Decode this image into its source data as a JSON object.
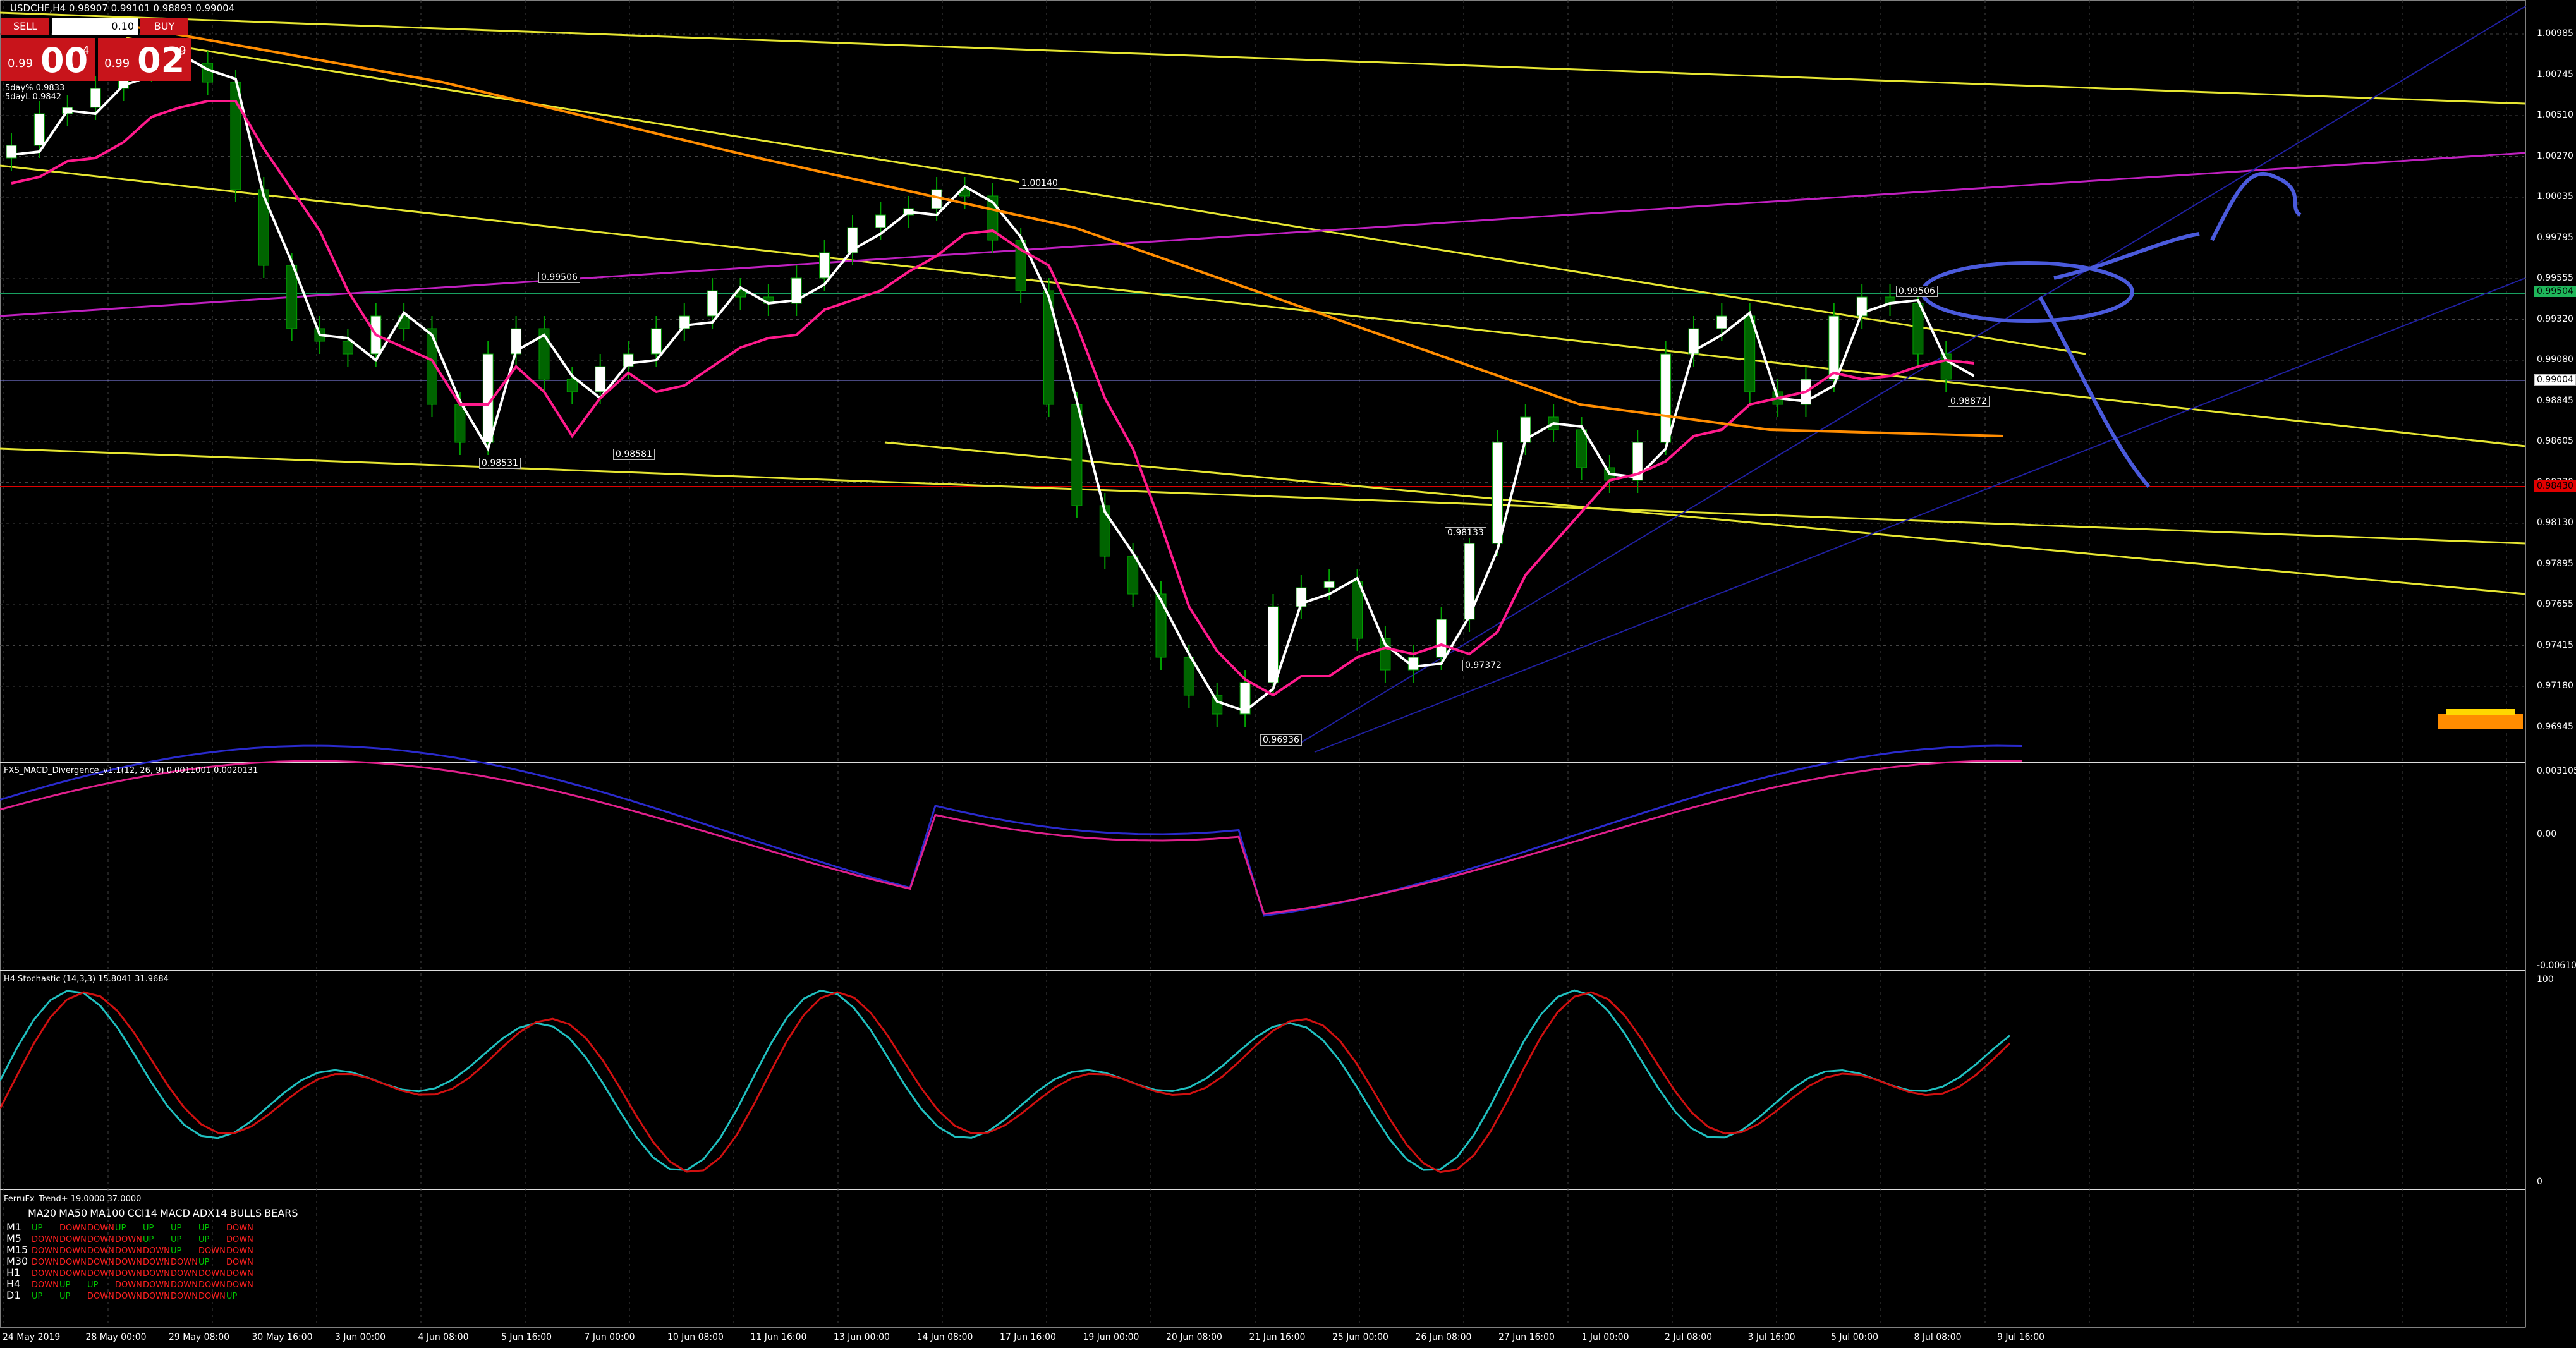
{
  "chart": {
    "title": "USDCHF,H4",
    "ohlc": "0.98907 0.99101 0.98893 0.99004",
    "ma_labels": [
      "5day% 0.9833",
      "5dayL 0.9842"
    ],
    "current_price": "0.99004",
    "price_levels": [
      "1.00985",
      "1.00745",
      "1.00510",
      "1.00270",
      "1.00035",
      "0.99795",
      "0.99555",
      "0.99320",
      "0.99080",
      "0.98845",
      "0.98605",
      "0.98370",
      "0.98130",
      "0.97895",
      "0.97655",
      "0.97415",
      "0.97180",
      "0.96945"
    ],
    "highlighted_levels": {
      "green": "0.99504",
      "red": "0.98430"
    },
    "swing_labels": [
      "1.00140",
      "0.99506",
      "0.98531",
      "0.98581",
      "0.99506",
      "0.98133",
      "0.97372",
      "0.96936",
      "0.98872"
    ]
  },
  "trade_panel": {
    "sell_label": "SELL",
    "buy_label": "BUY",
    "lot_size": "0.10",
    "sell_prefix": "0.99",
    "sell_big": "00",
    "sell_pip": "4",
    "buy_prefix": "0.99",
    "buy_big": "02",
    "buy_pip": "9"
  },
  "macd": {
    "title": "FXS_MACD_Divergence_v1.1(12, 26, 9) 0.0011001 0.0020131",
    "levels": [
      "0.0031059",
      "0.00",
      "-0.0061026"
    ]
  },
  "stochastic": {
    "title": "H4 Stochastic (14,3,3) 15.8041 31.9684",
    "levels": [
      "100",
      "0"
    ]
  },
  "trend": {
    "title": "FerruFx_Trend+ 19.0000 37.0000",
    "headers": [
      "MA20",
      "MA50",
      "MA100",
      "CCI14",
      "MACD",
      "ADX14",
      "BULLS",
      "BEARS"
    ],
    "rows": [
      {
        "tf": "M1",
        "cells": [
          "UP",
          "DOWN",
          "DOWN",
          "UP",
          "UP",
          "UP",
          "UP",
          "DOWN"
        ]
      },
      {
        "tf": "M5",
        "cells": [
          "DOWN",
          "DOWN",
          "DOWN",
          "DOWN",
          "UP",
          "UP",
          "UP",
          "DOWN"
        ]
      },
      {
        "tf": "M15",
        "cells": [
          "DOWN",
          "DOWN",
          "DOWN",
          "DOWN",
          "DOWN",
          "UP",
          "DOWN",
          "DOWN"
        ]
      },
      {
        "tf": "M30",
        "cells": [
          "DOWN",
          "DOWN",
          "DOWN",
          "DOWN",
          "DOWN",
          "DOWN",
          "UP",
          "DOWN"
        ]
      },
      {
        "tf": "H1",
        "cells": [
          "DOWN",
          "DOWN",
          "DOWN",
          "DOWN",
          "DOWN",
          "DOWN",
          "DOWN",
          "DOWN"
        ]
      },
      {
        "tf": "H4",
        "cells": [
          "DOWN",
          "UP",
          "UP",
          "DOWN",
          "DOWN",
          "DOWN",
          "DOWN",
          "DOWN"
        ]
      },
      {
        "tf": "D1",
        "cells": [
          "UP",
          "UP",
          "DOWN",
          "DOWN",
          "DOWN",
          "DOWN",
          "DOWN",
          "UP"
        ]
      }
    ]
  },
  "dates": [
    "24 May 2019",
    "28 May 00:00",
    "29 May 08:00",
    "30 May 16:00",
    "3 Jun 00:00",
    "4 Jun 08:00",
    "5 Jun 16:00",
    "7 Jun 00:00",
    "10 Jun 08:00",
    "11 Jun 16:00",
    "13 Jun 00:00",
    "14 Jun 08:00",
    "17 Jun 16:00",
    "19 Jun 00:00",
    "20 Jun 08:00",
    "21 Jun 16:00",
    "25 Jun 00:00",
    "26 Jun 08:00",
    "27 Jun 16:00",
    "1 Jul 00:00",
    "2 Jul 08:00",
    "3 Jul 16:00",
    "5 Jul 00:00",
    "8 Jul 08:00",
    "9 Jul 16:00"
  ],
  "colors": {
    "up": "#00c400",
    "down": "#ff2020",
    "candle": "#00a000",
    "ma_white": "#ffffff",
    "ma_pink": "#ff1a8c",
    "ma_orange": "#ff8c00",
    "trend_yellow": "#e6e632",
    "channel_magenta": "#c020c0",
    "drawing_blue": "#4a5adc"
  }
}
